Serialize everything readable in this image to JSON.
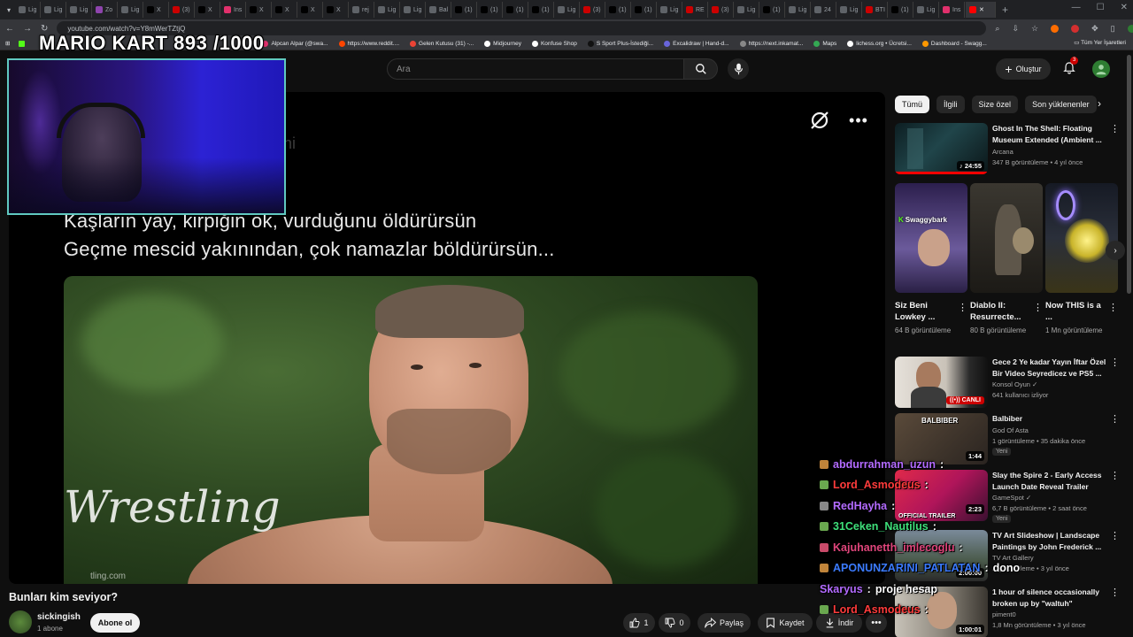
{
  "browser": {
    "tabs": [
      {
        "label": "Lig",
        "color": "#5f6368"
      },
      {
        "label": "Lig",
        "color": "#5f6368"
      },
      {
        "label": "Lig",
        "color": "#5f6368"
      },
      {
        "label": "Zo",
        "color": "#8e44ad"
      },
      {
        "label": "Lig",
        "color": "#5f6368"
      },
      {
        "label": "X",
        "color": "#000000"
      },
      {
        "label": "(3)",
        "color": "#cc0000"
      },
      {
        "label": "X",
        "color": "#000000"
      },
      {
        "label": "Ins",
        "color": "#e1306c"
      },
      {
        "label": "X",
        "color": "#000000"
      },
      {
        "label": "X",
        "color": "#000000"
      },
      {
        "label": "X",
        "color": "#000000"
      },
      {
        "label": "X",
        "color": "#000000"
      },
      {
        "label": "rej",
        "color": "#5f6368"
      },
      {
        "label": "Lig",
        "color": "#5f6368"
      },
      {
        "label": "Lig",
        "color": "#5f6368"
      },
      {
        "label": "Bal",
        "color": "#5f6368"
      },
      {
        "label": "(1)",
        "color": "#000000"
      },
      {
        "label": "(1)",
        "color": "#000000"
      },
      {
        "label": "(1)",
        "color": "#000000"
      },
      {
        "label": "(1)",
        "color": "#000000"
      },
      {
        "label": "Lig",
        "color": "#5f6368"
      },
      {
        "label": "(3)",
        "color": "#cc0000"
      },
      {
        "label": "(1)",
        "color": "#000000"
      },
      {
        "label": "(1)",
        "color": "#000000"
      },
      {
        "label": "Lig",
        "color": "#5f6368"
      },
      {
        "label": "RE",
        "color": "#cc0000"
      },
      {
        "label": "(3)",
        "color": "#cc0000"
      },
      {
        "label": "Lig",
        "color": "#5f6368"
      },
      {
        "label": "(1)",
        "color": "#000000"
      },
      {
        "label": "Lig",
        "color": "#5f6368"
      },
      {
        "label": "24",
        "color": "#5f6368"
      },
      {
        "label": "Lig",
        "color": "#5f6368"
      },
      {
        "label": "BTI",
        "color": "#cc0000"
      },
      {
        "label": "(1)",
        "color": "#000000"
      },
      {
        "label": "Lig",
        "color": "#5f6368"
      },
      {
        "label": "Ins",
        "color": "#e1306c"
      }
    ],
    "active_tab_label": "",
    "new_tab": "+",
    "url": "youtube.com/watch?v=Y8mWerTZtjQ",
    "bookmarks": [
      {
        "label": "Alpcan Alpar (@swa...",
        "color": "#e1306c"
      },
      {
        "label": "https://www.reddit....",
        "color": "#ff4500"
      },
      {
        "label": "Gelen Kutusu (31) -...",
        "color": "#ea4335"
      },
      {
        "label": "Midjourney",
        "color": "#ffffff"
      },
      {
        "label": "Konfuse Shop",
        "color": "#ffffff"
      },
      {
        "label": "S Sport Plus-İstediği...",
        "color": "#111111"
      },
      {
        "label": "Excalidraw | Hand-d...",
        "color": "#6965db"
      },
      {
        "label": "https://next.inkamat...",
        "color": "#888888"
      },
      {
        "label": "Maps",
        "color": "#34a853"
      },
      {
        "label": "lichess.org • Ücretsi...",
        "color": "#ffffff"
      },
      {
        "label": "Dashboard - Swagg...",
        "color": "#ff9800"
      }
    ],
    "bookmarks_all": "Tüm Yer İşaretleri"
  },
  "stream_overlay": {
    "title": "MARIO KART  893 /1000"
  },
  "header": {
    "search_placeholder": "Ara",
    "create_label": "Oluştur",
    "notifications_count": "3"
  },
  "player": {
    "ghost_text": "hi",
    "poem_line_1": "Kaşların yay, kirpiğin ok, vurduğunu öldürürsün",
    "poem_line_2": "Geçme mescid yakınından, çok namazlar böldürürsün...",
    "watermark": "Wrestling",
    "watermark_sub": "tling.com"
  },
  "video": {
    "title": "Bunları kim seviyor?",
    "channel": "sickingish",
    "subscribers": "1 abone",
    "subscribe_label": "Abone ol",
    "likes": "1",
    "dislikes": "0",
    "share_label": "Paylaş",
    "save_label": "Kaydet",
    "download_label": "İndir"
  },
  "sidebar": {
    "chips": [
      "Tümü",
      "İlgili",
      "Size özel",
      "Son yüklenenler"
    ],
    "rec_top": {
      "title": "Ghost In The Shell: Floating Museum Extended (Ambient ...",
      "channel": "Arcana",
      "meta": "347 B görüntüleme • 4 yıl önce",
      "duration": "24:55"
    },
    "shorts": [
      {
        "title": "Siz Beni Lowkey ...",
        "views": "64 B görüntüleme",
        "overlay": "Swaggybark"
      },
      {
        "title": "Diablo II: Resurrecte...",
        "views": "80 B görüntüleme"
      },
      {
        "title": "Now THIS is a ...",
        "views": "1 Mn görüntüleme"
      }
    ],
    "recs": [
      {
        "title": "Gece 2 Ye kadar Yayın İftar Özel Bir Video Seyredicez ve PS5 ...",
        "channel": "Konsol Oyun ✓",
        "meta": "641 kullanıcı izliyor",
        "live": "CANLI"
      },
      {
        "title": "Balbiber",
        "channel": "God Of Asta",
        "meta": "1 görüntüleme • 35 dakika önce",
        "duration": "1:44",
        "badge": "Yeni",
        "thumb_text": "BALBIBER"
      },
      {
        "title": "Slay the Spire 2 - Early Access Launch Date Reveal Trailer",
        "channel": "GameSpot ✓",
        "meta": "6,7 B görüntüleme • 2 saat önce",
        "duration": "2:23",
        "badge": "Yeni",
        "thumb_text": "OFFICIAL TRAILER"
      },
      {
        "title": "TV Art Slideshow | Landscape Paintings by John Frederick ...",
        "channel": "TV Art Gallery",
        "meta": "5 görüntüleme • 3 yıl önce",
        "duration": "2:00:00"
      },
      {
        "title": "1 hour of silence occasionally broken up by \"waltuh\"",
        "channel": "piment0",
        "meta": "1,8 Mn görüntüleme • 3 yıl önce",
        "duration": "1:00:01"
      }
    ]
  },
  "chat": [
    {
      "user": "abdurrahman_uzun",
      "sep": " :",
      "msg": "",
      "color": "#b36bff",
      "icon": "#c0843a"
    },
    {
      "user": "Lord_Asmodeus",
      "sep": " :",
      "msg": "",
      "color": "#ff3b3b",
      "icon": "#6aa84f"
    },
    {
      "user": "RedHayha",
      "sep": " :",
      "msg": "",
      "color": "#b36bff",
      "icon": "#888888"
    },
    {
      "user": "31Ceken_Nautilus",
      "sep": " :",
      "msg": "",
      "color": "#3ee07a",
      "icon": "#6aa84f"
    },
    {
      "user": "Kajuhanetth_imlecoglu",
      "sep": " :",
      "msg": "",
      "color": "#e0457b",
      "icon": "#c94b6a"
    },
    {
      "user": "APONUNZARINI_PATLATAN",
      "sep": " :",
      "msg": "dono",
      "color": "#3b7bff",
      "icon": "#c0843a"
    },
    {
      "user": "Skaryus",
      "sep": " :",
      "msg": "proje hesap",
      "color": "#b36bff",
      "icon": ""
    },
    {
      "user": "Lord_Asmodeus",
      "sep": " :",
      "msg": "",
      "color": "#ff3b3b",
      "icon": "#6aa84f"
    }
  ]
}
